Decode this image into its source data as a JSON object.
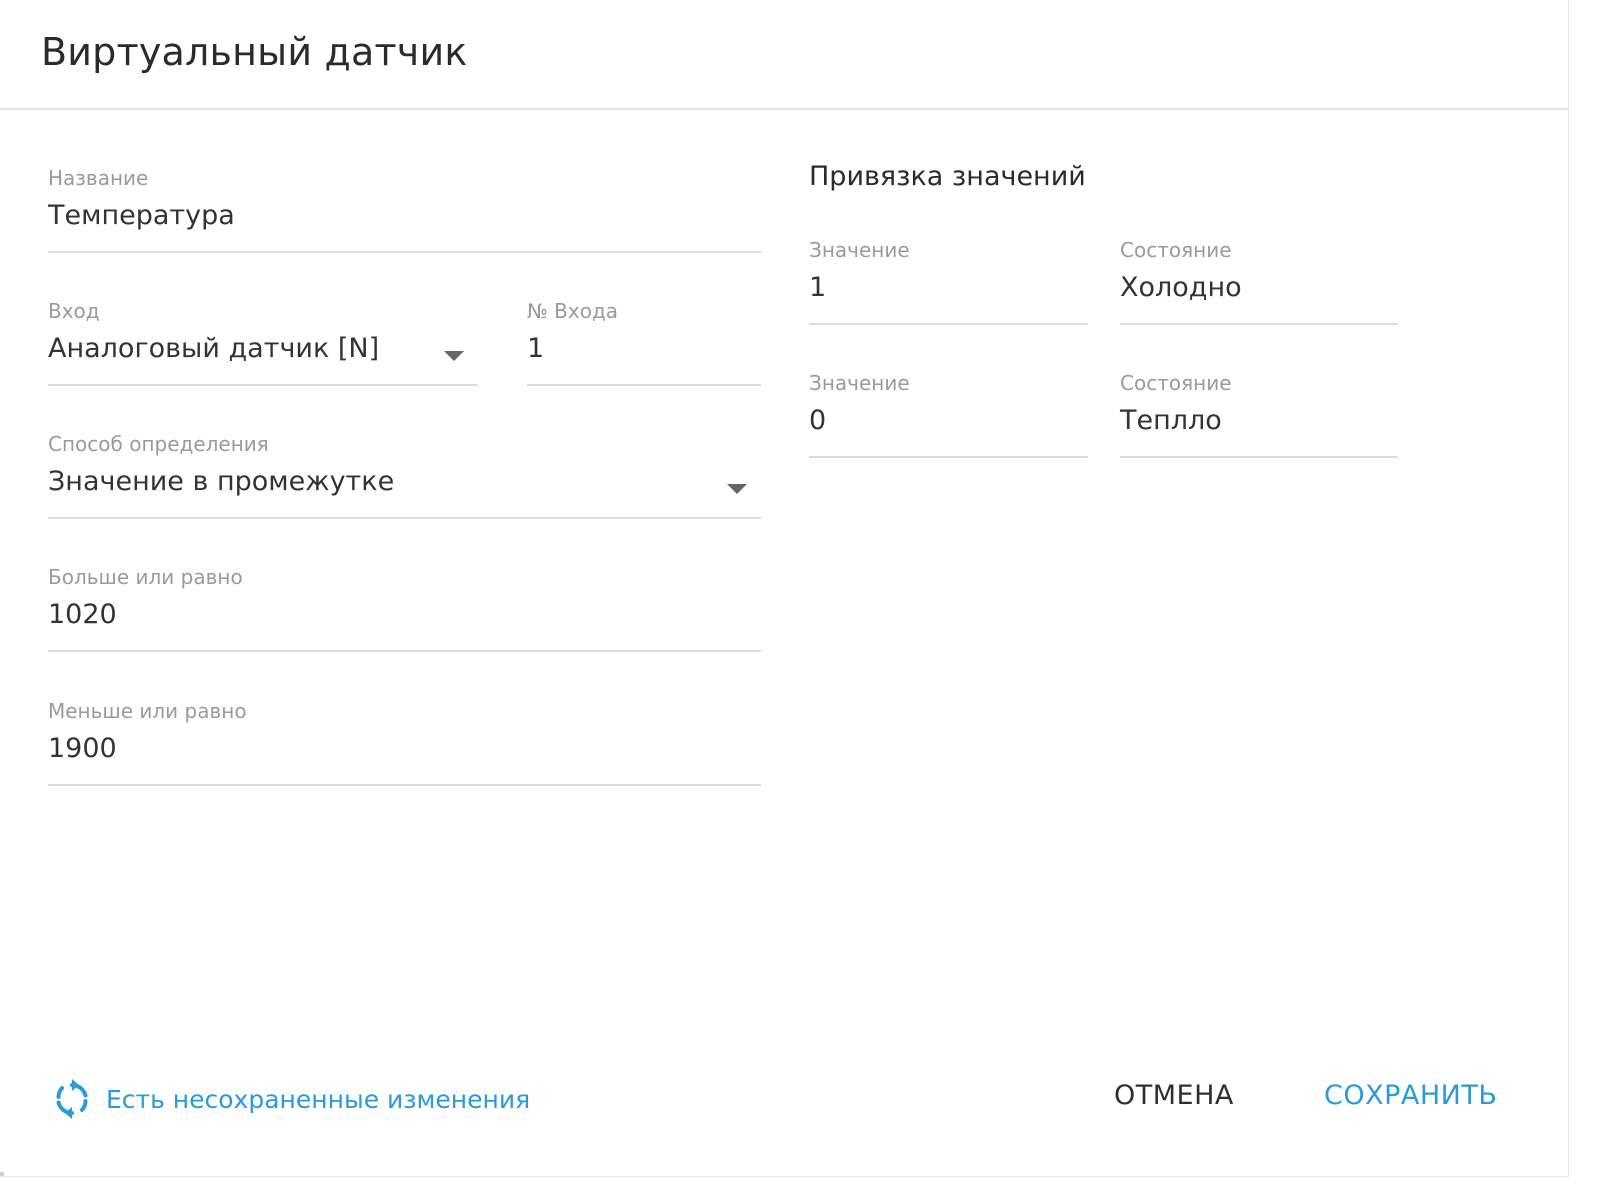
{
  "dialog": {
    "title": "Виртуальный датчик"
  },
  "form": {
    "name": {
      "label": "Название",
      "value": "Температура"
    },
    "input": {
      "label": "Вход",
      "value": "Аналоговый датчик [N]"
    },
    "input_number": {
      "label": "№ Входа",
      "value": "1"
    },
    "method": {
      "label": "Способ определения",
      "value": "Значение в промежутке"
    },
    "gte": {
      "label": "Больше или равно",
      "value": "1020"
    },
    "lte": {
      "label": "Меньше или равно",
      "value": "1900"
    }
  },
  "binding": {
    "title": "Привязка значений",
    "rows": [
      {
        "value_label": "Значение",
        "value": "1",
        "state_label": "Состояние",
        "state": "Холодно"
      },
      {
        "value_label": "Значение",
        "value": "0",
        "state_label": "Состояние",
        "state": "Теплло"
      }
    ]
  },
  "footer": {
    "unsaved_text": "Есть несохраненные изменения",
    "unsaved_icon": "sync-icon",
    "cancel_label": "ОТМЕНА",
    "save_label": "СОХРАНИТЬ"
  },
  "colors": {
    "accent": "#2b9ad8",
    "label": "#9a9a9a",
    "text": "#333333",
    "divider": "#dcdcdc"
  }
}
